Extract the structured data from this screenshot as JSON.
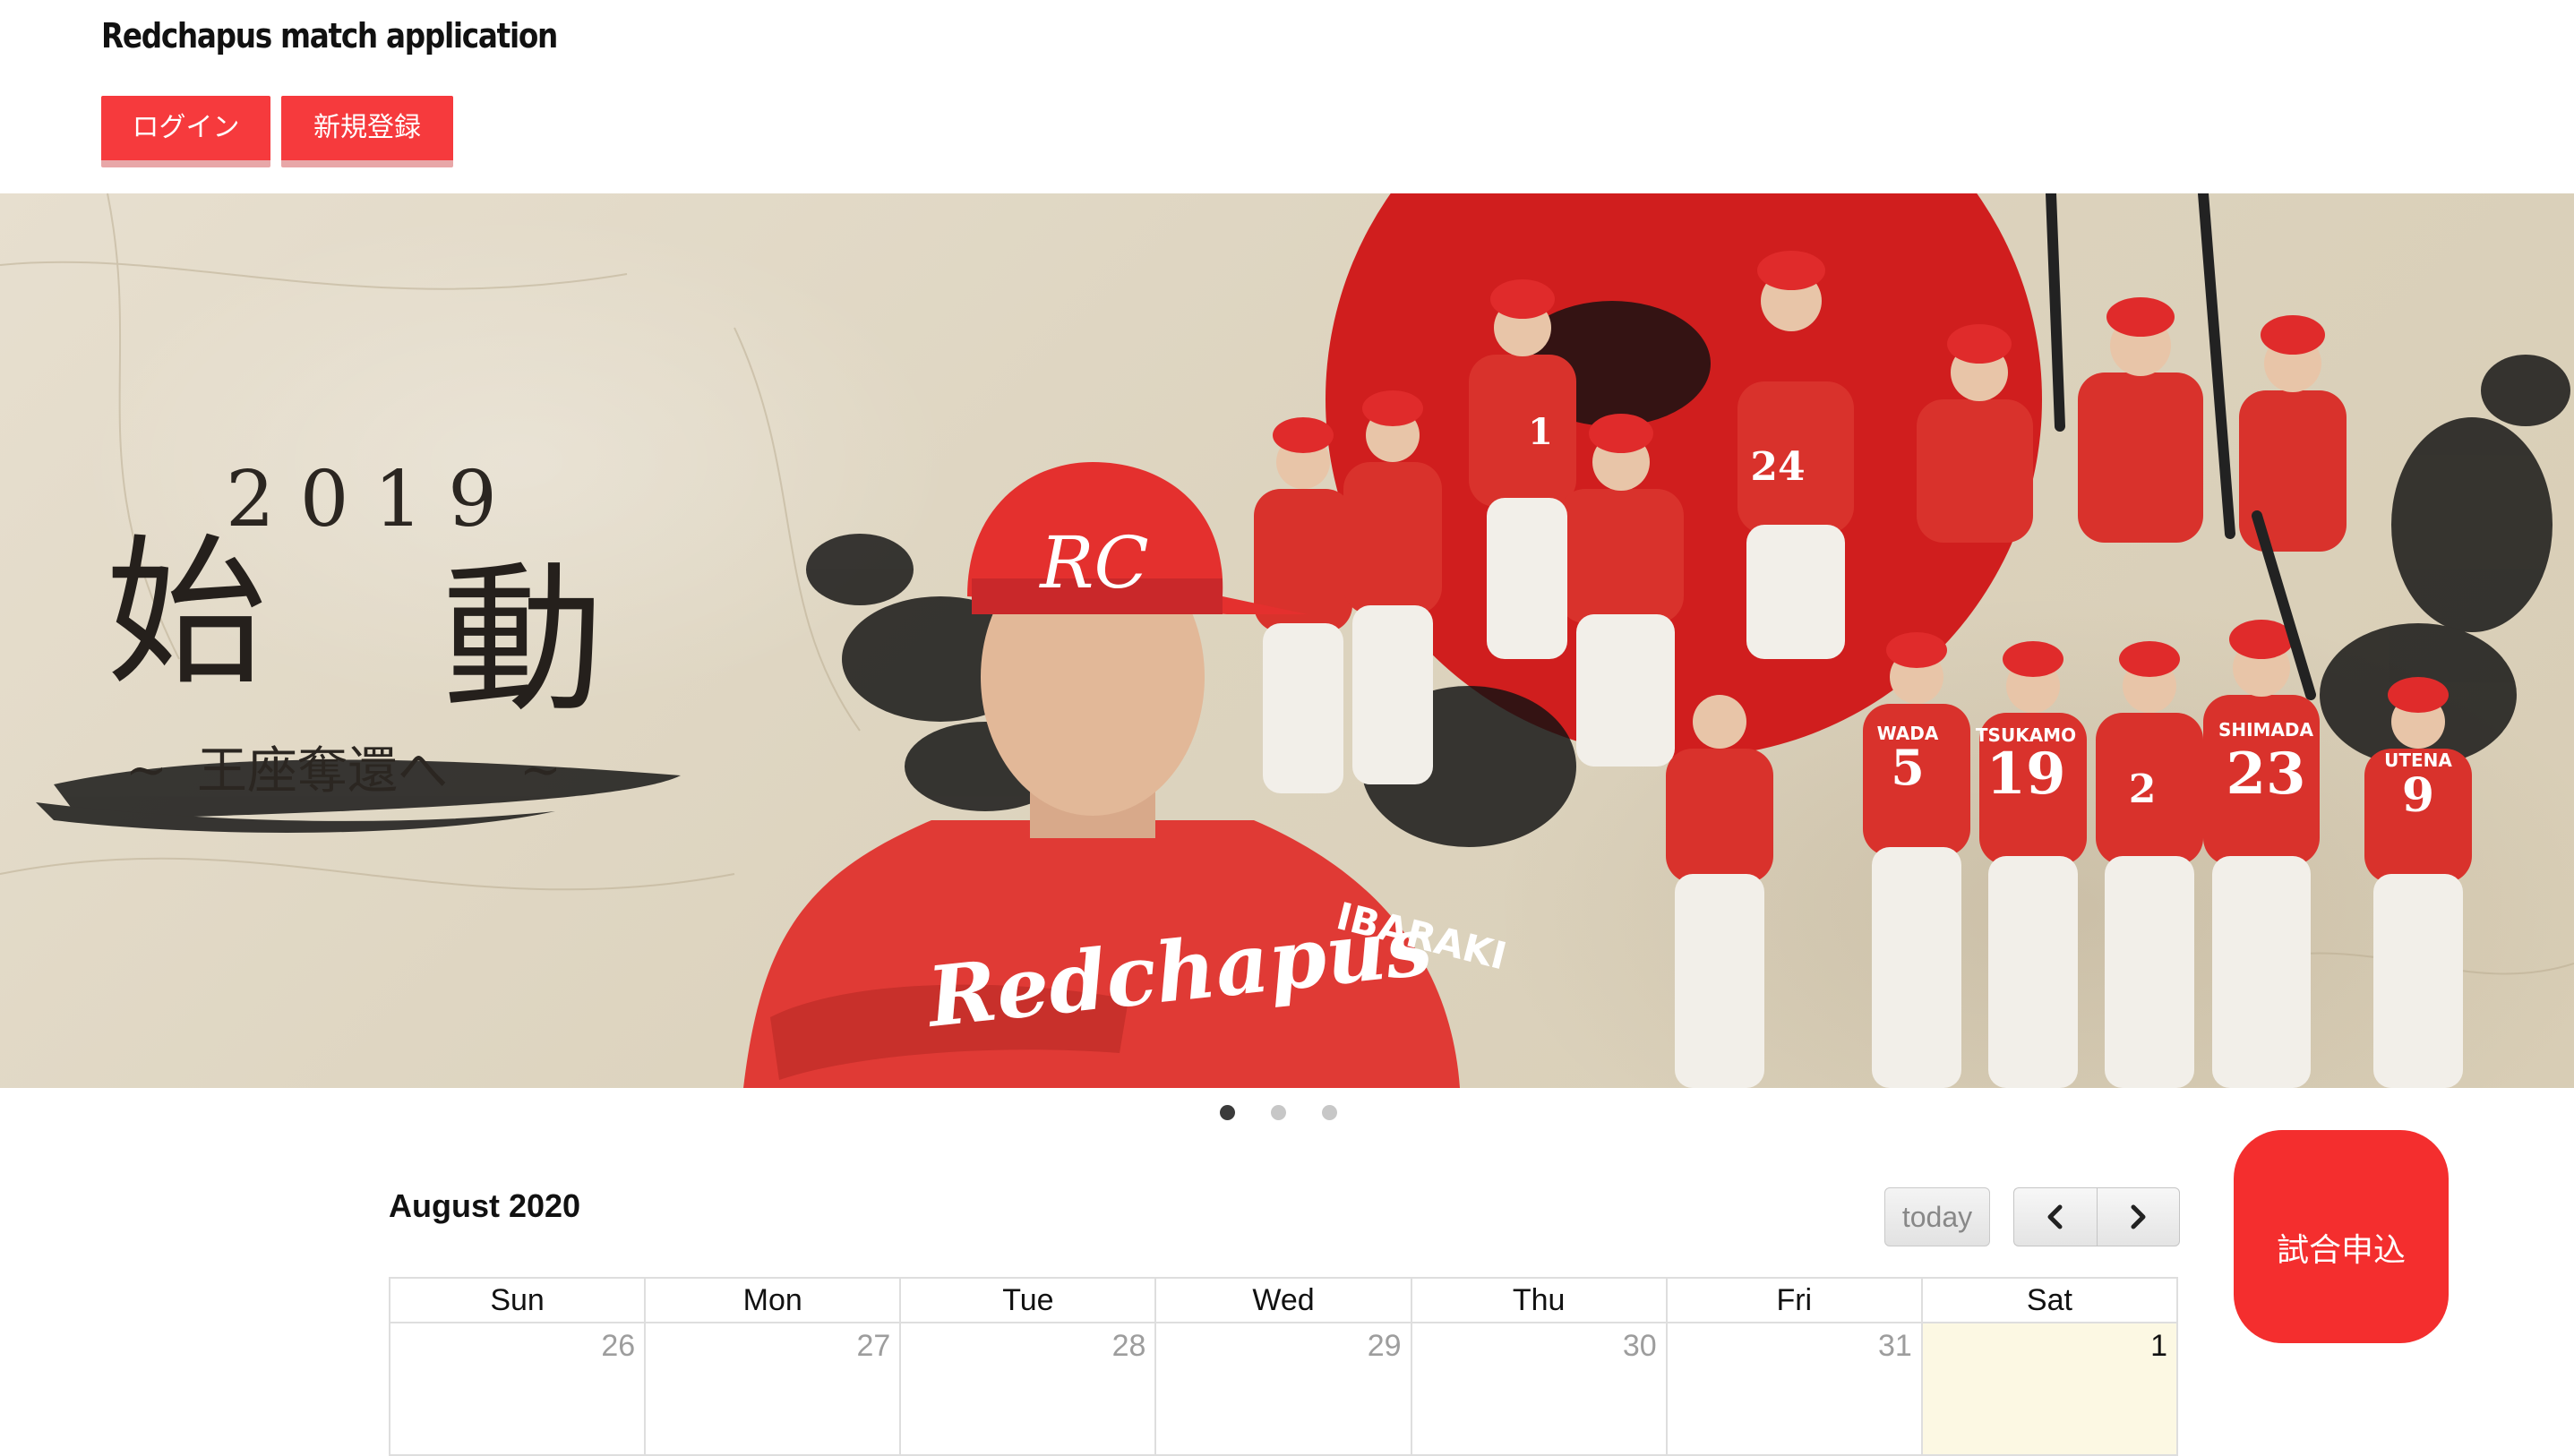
{
  "header": {
    "app_title": "Redchapus match application",
    "login_label": "ログイン",
    "signup_label": "新規登録"
  },
  "hero": {
    "year": "2019",
    "kanji_left": "始",
    "kanji_right": "動",
    "subtitle": "王座奪還へ",
    "tilde": "~",
    "jersey_numbers": [
      "24",
      "1",
      "5",
      "19",
      "2",
      "23",
      "9"
    ],
    "jersey_names": [
      "WADA",
      "TSUKAMO",
      "SHIMADA",
      "UTENA"
    ],
    "chest_text": "Redchapus",
    "sleeve_text": "IBARAKI",
    "cap_logo": "RC",
    "slide_count": 3,
    "active_slide": 0
  },
  "calendar": {
    "title": "August 2020",
    "today_label": "today",
    "weekdays": [
      "Sun",
      "Mon",
      "Tue",
      "Wed",
      "Thu",
      "Fri",
      "Sat"
    ],
    "days": [
      "26",
      "27",
      "28",
      "29",
      "30",
      "31",
      "1"
    ]
  },
  "apply_button_label": "試合申込",
  "colors": {
    "brand_red": "#f63a3d",
    "today_cell": "#fcf8e3",
    "hero_paper": "#e0d7c3",
    "rising_sun": "#d01e1e"
  }
}
